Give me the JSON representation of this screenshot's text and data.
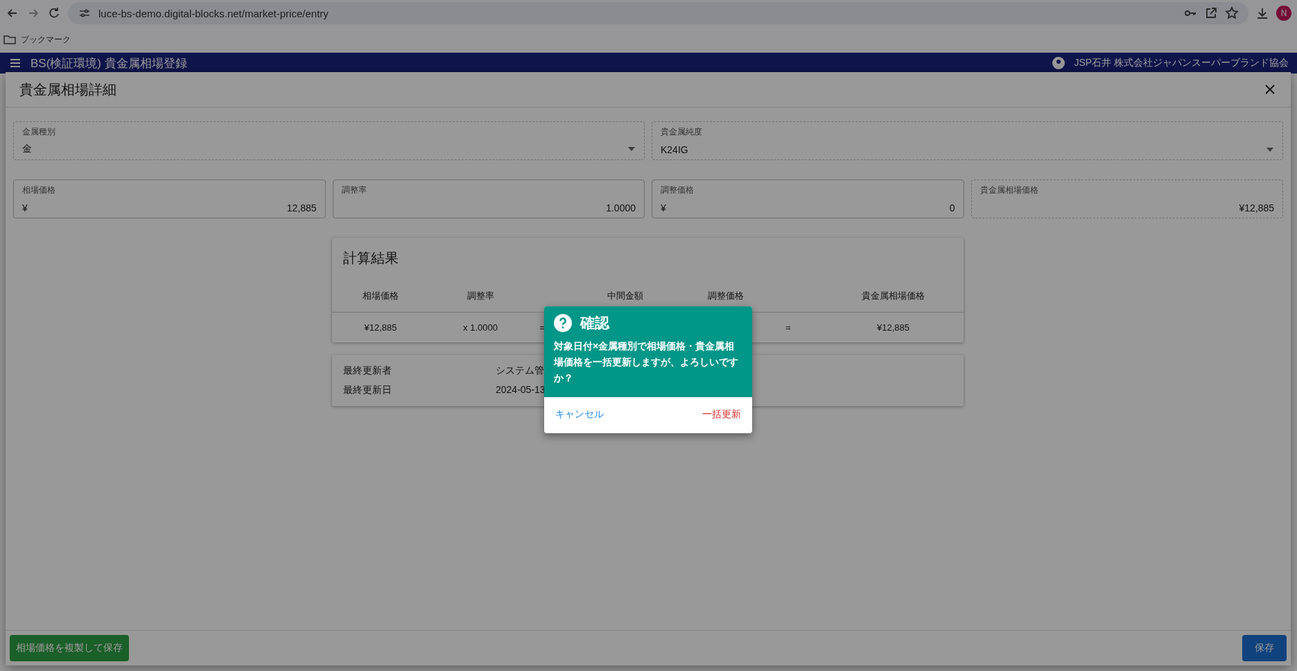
{
  "browser": {
    "url": "luce-bs-demo.digital-blocks.net/market-price/entry",
    "bookmarks_label": "ブックマーク",
    "profile_initial": "N"
  },
  "app_header": {
    "title": "BS(検証環境) 貴金属相場登録",
    "user": "JSP石井 株式会社ジャパンスーパーブランド協会"
  },
  "dialog": {
    "title": "貴金属相場詳細",
    "select_fields": [
      {
        "label": "金属種別",
        "value": "金"
      },
      {
        "label": "貴金属純度",
        "value": "K24IG"
      }
    ],
    "price_fields": [
      {
        "kind": "input",
        "label": "相場価格",
        "prefix": "¥",
        "value": "12,885"
      },
      {
        "kind": "input",
        "label": "調整率",
        "value": "1.0000"
      },
      {
        "kind": "input",
        "label": "調整価格",
        "prefix": "¥",
        "value": "0"
      },
      {
        "kind": "readonly",
        "label": "貴金属相場価格",
        "value": "¥12,885"
      }
    ],
    "calc": {
      "title": "計算結果",
      "columns": [
        "相場価格",
        "調整率",
        "中間金額",
        "調整価格",
        "貴金属相場価格"
      ],
      "row": {
        "left": [
          "¥12,885",
          "x 1.0000",
          "="
        ],
        "right": [
          "=",
          "¥12,885"
        ]
      }
    },
    "audit": [
      {
        "label": "最終更新者",
        "value": "システム管"
      },
      {
        "label": "最終更新日",
        "value": "2024-05-13"
      }
    ],
    "copy_save_button": "相場価格を複製して保存",
    "save_button": "保存"
  },
  "confirm": {
    "title": "確認",
    "message": "対象日付×金属種別で相場価格・貴金属相場価格を一括更新しますが、よろしいですか？",
    "cancel": "キャンセル",
    "ok": "一括更新"
  }
}
